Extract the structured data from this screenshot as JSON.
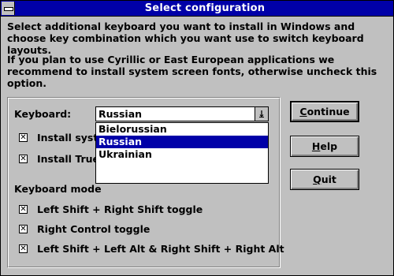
{
  "window": {
    "title": "Select configuration"
  },
  "text": {
    "intro": "Select additional keyboard you want to install in Windows and choose key combination which you want use to switch keyboard layouts.",
    "note": "If you plan to use Cyrillic or East European applications we recommend to install system screen fonts, otherwise uncheck this option."
  },
  "keyboard": {
    "label": "Keyboard:",
    "selected": "Russian",
    "options": [
      "Bielorussian",
      "Russian",
      "Ukrainian"
    ]
  },
  "options": [
    {
      "label_visible": "Install syste",
      "checked": true
    },
    {
      "label_visible": "Install True",
      "checked": true
    }
  ],
  "modes": {
    "label_visible": "Keyboard mode",
    "items": [
      {
        "label": "Left Shift + Right Shift toggle",
        "checked": true
      },
      {
        "label": "Right Control toggle",
        "checked": true
      },
      {
        "label": "Left Shift + Left Alt & Right Shift + Right Alt",
        "checked": true
      }
    ]
  },
  "buttons": {
    "continue_first": "C",
    "continue_rest": "ontinue",
    "help_first": "H",
    "help_rest": "elp",
    "quit_first": "Q",
    "quit_rest": "uit"
  },
  "colors": {
    "titlebar": "#0000a8",
    "face": "#c0c0c0",
    "highlight": "#0000a8"
  },
  "icons": {
    "system_menu": "system-menu-icon",
    "dropdown": "dropdown-arrow-icon",
    "check": "checkbox-x-icon"
  }
}
